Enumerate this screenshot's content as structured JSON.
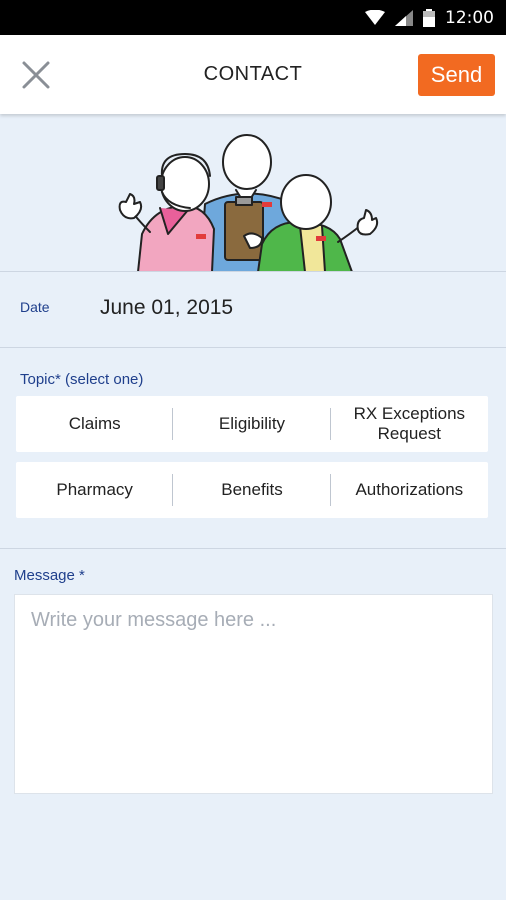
{
  "status_bar": {
    "time": "12:00"
  },
  "header": {
    "title": "CONTACT",
    "send_label": "Send"
  },
  "date": {
    "label": "Date",
    "value": "June 01, 2015"
  },
  "topic": {
    "label": "Topic* (select one)",
    "row1": [
      "Claims",
      "Eligibility",
      "RX Exceptions Request"
    ],
    "row2": [
      "Pharmacy",
      "Benefits",
      "Authorizations"
    ]
  },
  "message": {
    "label": "Message *",
    "placeholder": "Write your message here ...",
    "value": ""
  },
  "colors": {
    "accent": "#f26a21",
    "label_blue": "#1f3f8c",
    "background": "#e8f0f9"
  }
}
